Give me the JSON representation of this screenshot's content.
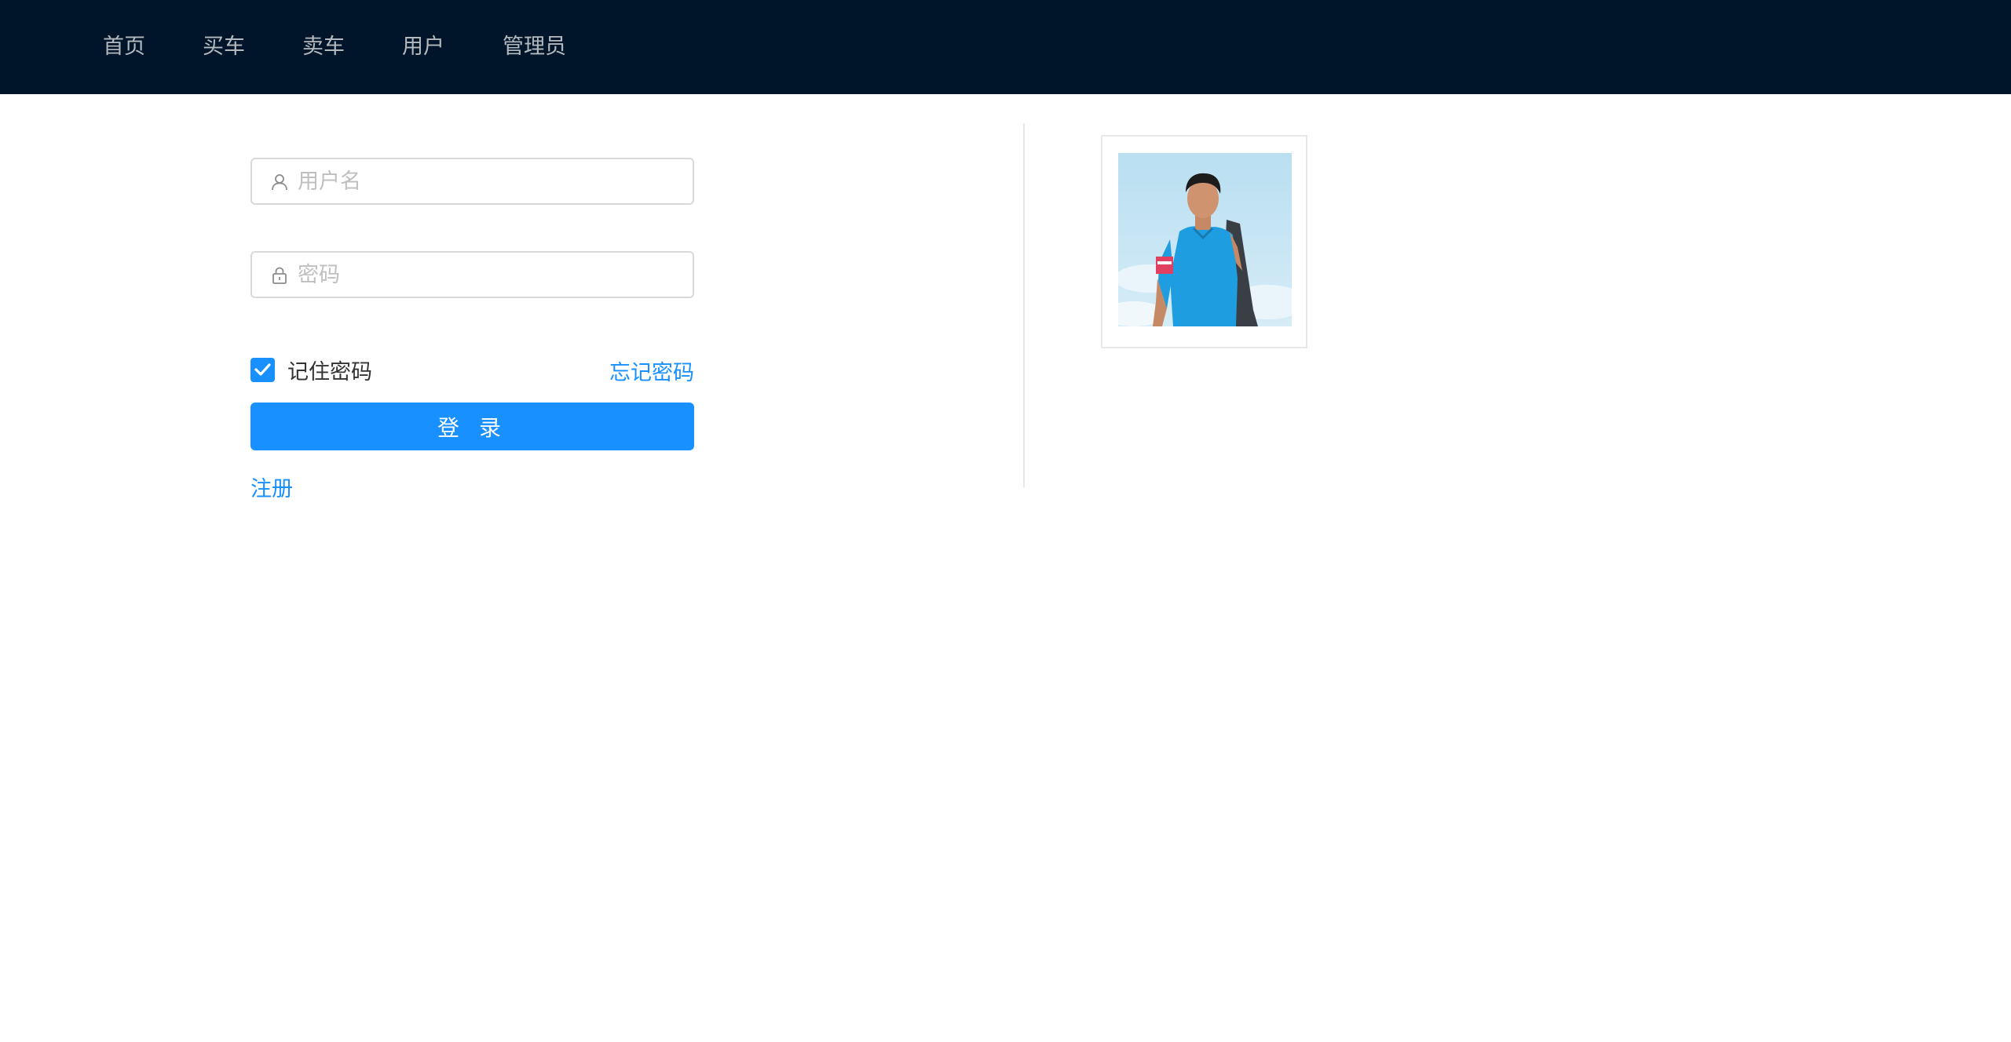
{
  "nav": {
    "items": [
      {
        "label": "首页"
      },
      {
        "label": "买车"
      },
      {
        "label": "卖车"
      },
      {
        "label": "用户"
      },
      {
        "label": "管理员"
      }
    ],
    "background": "#001529"
  },
  "login": {
    "username_placeholder": "用户名",
    "username_value": "",
    "password_placeholder": "密码",
    "password_value": "",
    "remember_label": "记住密码",
    "remember_checked": true,
    "forgot_label": "忘记密码",
    "submit_label": "登 录",
    "register_label": "注册",
    "accent": "#1890ff"
  },
  "icons": {
    "username": "user-icon",
    "password": "lock-icon",
    "check": "check-icon"
  }
}
